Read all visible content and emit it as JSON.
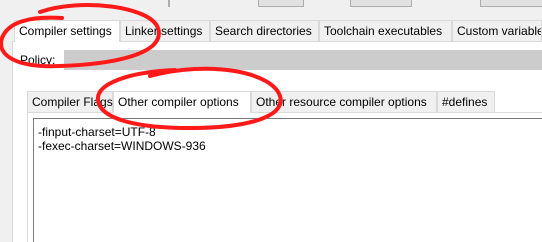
{
  "outer_tabs": [
    {
      "label": "Compiler settings",
      "active": true
    },
    {
      "label": "Linker settings",
      "active": false
    },
    {
      "label": "Search directories",
      "active": false
    },
    {
      "label": "Toolchain executables",
      "active": false
    },
    {
      "label": "Custom variables",
      "active": false
    }
  ],
  "policy": {
    "label": "Policy:"
  },
  "inner_tabs": [
    {
      "label": "Compiler Flags",
      "active": false
    },
    {
      "label": "Other compiler options",
      "active": true
    },
    {
      "label": "Other resource compiler options",
      "active": false
    },
    {
      "label": "#defines",
      "active": false
    }
  ],
  "editor": {
    "lines": [
      "-finput-charset=UTF-8",
      "-fexec-charset=WINDOWS-936"
    ]
  },
  "annotation_color": "#ff1a1a"
}
